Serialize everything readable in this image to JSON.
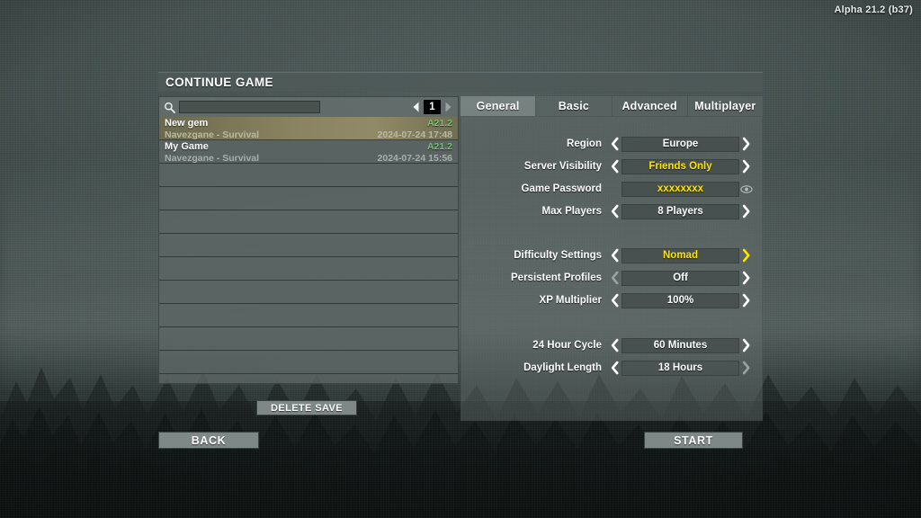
{
  "version_label": "Alpha 21.2 (b37)",
  "colors": {
    "accent_yellow": "#ffe400",
    "version_green": "#73c36e",
    "panel_gray": "#68736f",
    "button_gray": "#7e8886",
    "selected_row": "#918a66"
  },
  "header": {
    "title": "CONTINUE GAME"
  },
  "left_panel": {
    "search": {
      "value": "",
      "placeholder": "",
      "icon": "search-icon"
    },
    "pager": {
      "prev_icon": "chevron-left-icon",
      "next_icon": "chevron-right-icon",
      "page": "1"
    },
    "saves": [
      {
        "name": "New gem",
        "version": "A21.2",
        "world": "Navezgane - Survival",
        "datetime": "2024-07-24 17:48",
        "selected": true
      },
      {
        "name": "My Game",
        "version": "A21.2",
        "world": "Navezgane - Survival",
        "datetime": "2024-07-24 15:56",
        "selected": false
      }
    ],
    "empty_row_count": 9,
    "delete_save_label": "DELETE SAVE"
  },
  "right_panel": {
    "tabs": [
      {
        "label": "General",
        "active": true
      },
      {
        "label": "Basic",
        "active": false
      },
      {
        "label": "Advanced",
        "active": false
      },
      {
        "label": "Multiplayer",
        "active": false
      }
    ],
    "groups": [
      {
        "options": [
          {
            "label": "Region",
            "value": "Europe",
            "value_highlighted": false,
            "left_arrow": "active",
            "right_arrow": "active",
            "control": "stepper"
          },
          {
            "label": "Server Visibility",
            "value": "Friends Only",
            "value_highlighted": true,
            "left_arrow": "active",
            "right_arrow": "active",
            "control": "stepper"
          },
          {
            "label": "Game Password",
            "value": "xxxxxxxx",
            "value_highlighted": true,
            "left_arrow": "none",
            "right_arrow": "none",
            "control": "password",
            "reveal_icon": "eye-icon"
          },
          {
            "label": "Max Players",
            "value": "8 Players",
            "value_highlighted": false,
            "left_arrow": "active",
            "right_arrow": "active",
            "control": "stepper"
          }
        ]
      },
      {
        "options": [
          {
            "label": "Difficulty Settings",
            "value": "Nomad",
            "value_highlighted": true,
            "left_arrow": "active",
            "right_arrow": "highlight",
            "control": "stepper"
          },
          {
            "label": "Persistent Profiles",
            "value": "Off",
            "value_highlighted": false,
            "left_arrow": "dim",
            "right_arrow": "active",
            "control": "stepper"
          },
          {
            "label": "XP Multiplier",
            "value": "100%",
            "value_highlighted": false,
            "left_arrow": "active",
            "right_arrow": "active",
            "control": "stepper"
          }
        ]
      },
      {
        "options": [
          {
            "label": "24 Hour Cycle",
            "value": "60 Minutes",
            "value_highlighted": false,
            "left_arrow": "active",
            "right_arrow": "active",
            "control": "stepper"
          },
          {
            "label": "Daylight Length",
            "value": "18 Hours",
            "value_highlighted": false,
            "left_arrow": "active",
            "right_arrow": "dim",
            "control": "stepper",
            "translucent": true
          }
        ]
      }
    ]
  },
  "footer": {
    "back_label": "BACK",
    "start_label": "START"
  }
}
